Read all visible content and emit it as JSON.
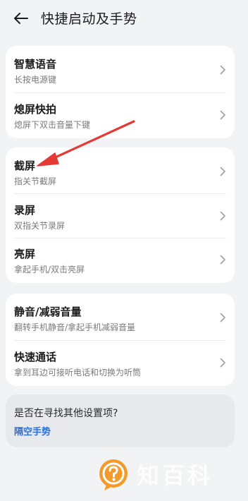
{
  "header": {
    "title": "快捷启动及手势"
  },
  "groups": [
    {
      "items": [
        {
          "title": "智慧语音",
          "subtitle": "长按电源键"
        },
        {
          "title": "熄屏快拍",
          "subtitle": "熄屏下双击音量下键"
        }
      ]
    },
    {
      "items": [
        {
          "title": "截屏",
          "subtitle": "指关节截屏"
        },
        {
          "title": "录屏",
          "subtitle": "双指关节录屏"
        },
        {
          "title": "亮屏",
          "subtitle": "拿起手机/双击亮屏"
        }
      ]
    },
    {
      "items": [
        {
          "title": "静音/减弱音量",
          "subtitle": "翻转手机静音/拿起手机减弱音量"
        },
        {
          "title": "快速通话",
          "subtitle": "拿到耳边可接听电话和切换为听筒"
        }
      ]
    }
  ],
  "hint": {
    "question": "是否在寻找其他设置项?",
    "link": "隔空手势"
  },
  "watermark": {
    "text": "知百科"
  },
  "colors": {
    "background": "#f1f3f5",
    "card": "#ffffff",
    "link": "#2d6fd6",
    "annotation_arrow": "#e53935",
    "watermark_logo": "#f39a2b"
  },
  "icons": [
    "back-arrow-icon",
    "chevron-right-icon",
    "annotation-arrow",
    "watermark-logo-icon"
  ]
}
